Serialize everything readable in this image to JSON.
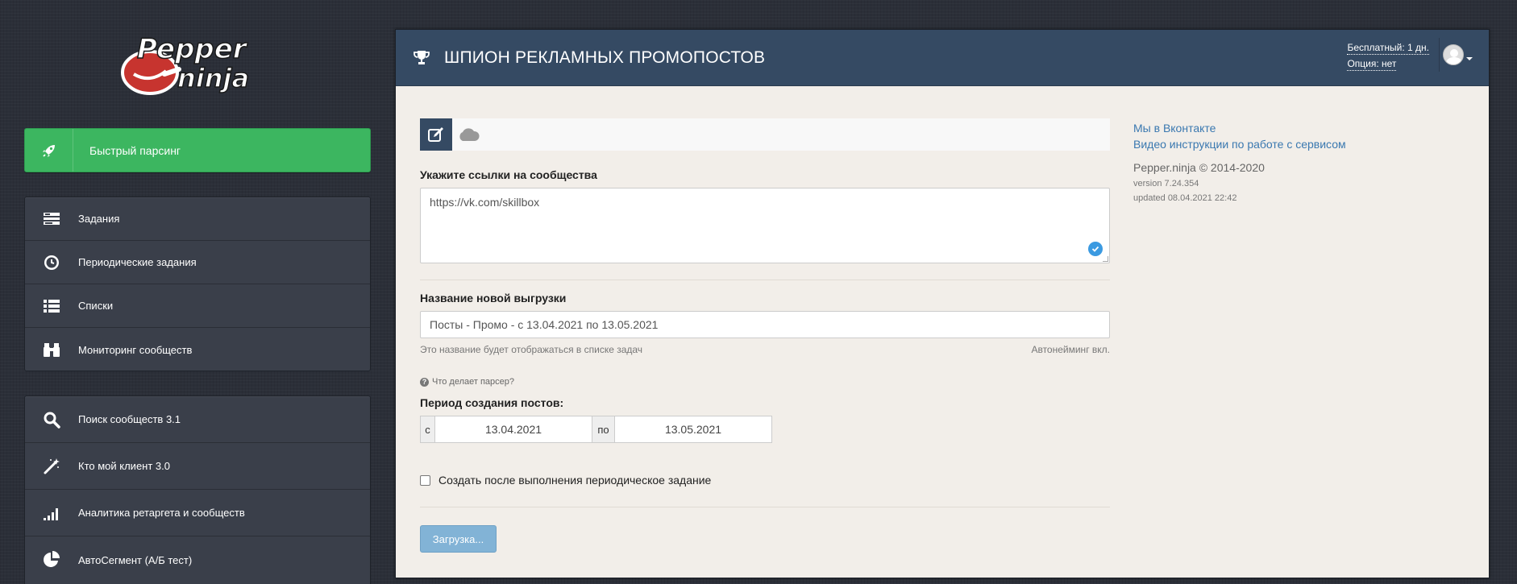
{
  "logo": {
    "text_line1": "Pepper",
    "text_line2": "ninja"
  },
  "sidebar": {
    "quick_parse": {
      "label": "Быстрый парсинг",
      "icon": "rocket-icon"
    },
    "group1": [
      {
        "label": "Задания",
        "icon": "tasks-icon"
      },
      {
        "label": "Периодические задания",
        "icon": "clock-icon"
      },
      {
        "label": "Списки",
        "icon": "list-icon"
      },
      {
        "label": "Мониторинг сообществ",
        "icon": "binoculars-icon"
      }
    ],
    "group2": [
      {
        "label": "Поиск сообществ 3.1",
        "icon": "search-icon"
      },
      {
        "label": "Кто мой клиент 3.0",
        "icon": "magic-wand-icon"
      },
      {
        "label": "Аналитика ретаргета и сообществ",
        "icon": "signal-bars-icon"
      },
      {
        "label": "АвтоСегмент (А/Б тест)",
        "icon": "pie-chart-icon"
      }
    ]
  },
  "header": {
    "title": "ШПИОН РЕКЛАМНЫХ ПРОМОПОСТОВ",
    "plan": "Бесплатный: 1 дн.",
    "option": "Опция: нет"
  },
  "form": {
    "communities_label": "Укажите ссылки на сообщества",
    "communities_value": "https://vk.com/skillbox",
    "export_name_label": "Название новой выгрузки",
    "export_name_value": "Посты - Промо - с 13.04.2021 по 13.05.2021",
    "export_name_help": "Это название будет отображаться в списке задач",
    "autonaming": "Автонейминг вкл.",
    "what_does": "Что делает парсер?",
    "period_label": "Период создания постов:",
    "from_label": "с",
    "from_date": "13.04.2021",
    "to_label": "по",
    "to_date": "13.05.2021",
    "periodic_checkbox_label": "Создать после выполнения периодическое задание",
    "periodic_checked": false,
    "submit_label": "Загрузка..."
  },
  "side_info": {
    "vk_link": "Мы в Вконтакте",
    "video_link": "Видео инструкции по работе с сервисом",
    "copyright": "Pepper.ninja © 2014-2020",
    "version": "version 7.24.354",
    "updated": "updated 08.04.2021 22:42"
  },
  "colors": {
    "quick_green": "#3cb660",
    "header_blue": "#354a63",
    "panel_bg": "#f2eee9",
    "link_blue": "#3a78b0",
    "button_disabled_blue": "#82b3d6"
  }
}
